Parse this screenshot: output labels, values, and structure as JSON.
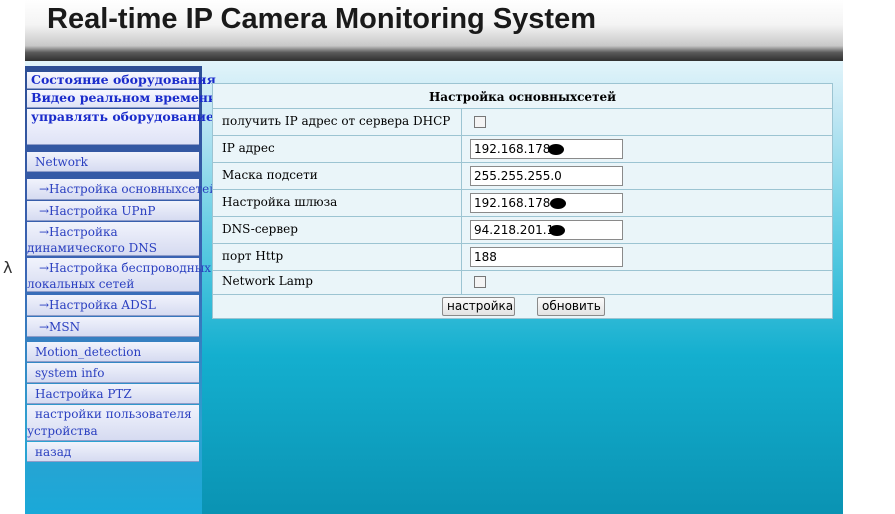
{
  "header": {
    "title": "Real-time IP Camera Monitoring System"
  },
  "sidebar": {
    "status": "Состояние оборудования",
    "live_video": "Видео реальном времени",
    "manage_line1": "управлять",
    "manage_line2": "оборудованием",
    "network": "Network",
    "net_basic": "→Настройка основныхсетей",
    "net_upnp": "→Настройка UPnP",
    "net_ddns_line1": "→Настройка",
    "net_ddns_line2": "динамического DNS",
    "net_wifi_line1": "→Настройка беспроводных",
    "net_wifi_line2": "локальных сетей",
    "net_adsl": "→Настройка ADSL",
    "net_msn": "→MSN",
    "motion": "Motion_detection",
    "sysinfo": "system info",
    "ptz": "Настройка PTZ",
    "users_line1": "настройки пользователя",
    "users_line2": "устройства",
    "back": "назад"
  },
  "stray_char": "λ",
  "panel": {
    "title": "Настройка основныхсетей",
    "dhcp_label": "получить IP адрес от сервера DHCP",
    "ip_label": "IP адрес",
    "ip_value": "192.168.178",
    "mask_label": "Маска подсети",
    "mask_value": "255.255.255.0",
    "gateway_label": "Настройка шлюза",
    "gateway_value": "192.168.178.",
    "dns_label": "DNS-сервер",
    "dns_value": "94.218.201.1",
    "http_label": "порт Http",
    "http_value": "188",
    "lamp_label": "Network Lamp",
    "apply_button": "настройка",
    "refresh_button": "обновить"
  }
}
